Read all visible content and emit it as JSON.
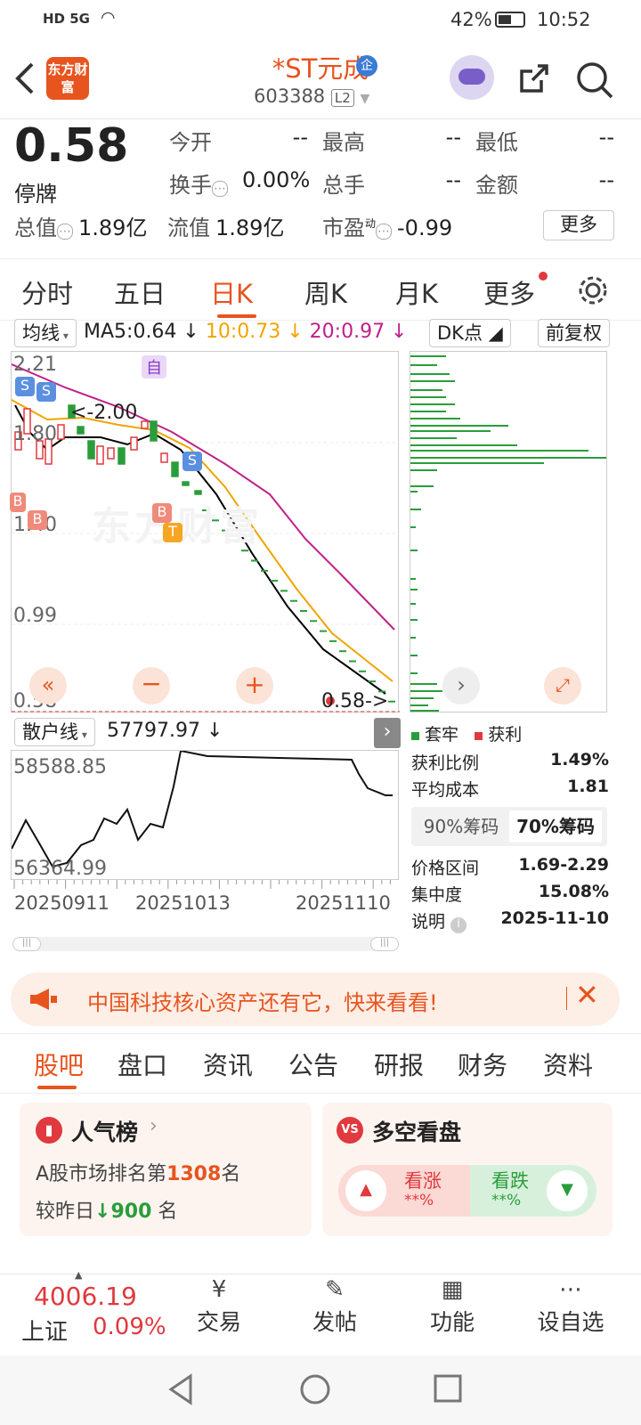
{
  "status_bar": {
    "left": "HD 5G",
    "battery": "42%",
    "time": "10:52"
  },
  "header": {
    "logo": "东方财富",
    "title": "*ST元成",
    "code": "603388",
    "level": "L2"
  },
  "quote": {
    "price": "0.58",
    "status": "停牌",
    "fields": [
      {
        "label": "今开",
        "value": "--"
      },
      {
        "label": "最高",
        "value": "--"
      },
      {
        "label": "最低",
        "value": "--"
      },
      {
        "label": "换手",
        "value": "0.00%"
      },
      {
        "label": "总手",
        "value": "--"
      },
      {
        "label": "金额",
        "value": "--"
      },
      {
        "label": "总值",
        "value": "1.89亿"
      },
      {
        "label": "流值",
        "value": "1.89亿"
      },
      {
        "label": "市盈",
        "value": "-0.99",
        "sup": "动"
      }
    ],
    "more": "更多"
  },
  "period_tabs": [
    "分时",
    "五日",
    "日K",
    "周K",
    "月K",
    "更多"
  ],
  "ma_bar": {
    "selector": "均线",
    "ma5": "MA5:0.64",
    "ma10": "10:0.73",
    "ma20": "20:0.97",
    "dk": "DK点",
    "adjust": "前复权"
  },
  "kline": {
    "y_labels": [
      "2.21",
      "1.80",
      "1.40",
      "0.99",
      "0.58"
    ],
    "annotations": {
      "low": "<-2.00",
      "last": "0.58->",
      "self": "自"
    },
    "markers": {
      "s": "S",
      "b": "B",
      "t": "T"
    },
    "watermark": "东方财富"
  },
  "sub_chart": {
    "selector": "散户线",
    "value": "57797.97",
    "y_labels": [
      "58588.85",
      "56364.99"
    ],
    "dates": [
      "20250911",
      "20251013",
      "20251110"
    ]
  },
  "chips": {
    "legend": [
      "套牢",
      "获利"
    ],
    "rows": [
      {
        "label": "获利比例",
        "value": "1.49%"
      },
      {
        "label": "平均成本",
        "value": "1.81"
      }
    ],
    "tabs": [
      "90%筹码",
      "70%筹码"
    ],
    "rows2": [
      {
        "label": "价格区间",
        "value": "1.69-2.29"
      },
      {
        "label": "集中度",
        "value": "15.08%"
      },
      {
        "label": "说明",
        "value": "2025-11-10"
      }
    ]
  },
  "banner": {
    "text": "中国科技核心资产还有它，快来看看!"
  },
  "content_tabs": [
    "股吧",
    "盘口",
    "资讯",
    "公告",
    "研报",
    "财务",
    "资料"
  ],
  "cards": {
    "popularity": {
      "title": "人气榜",
      "line1_prefix": "A股市场排名第",
      "rank": "1308",
      "line1_suffix": "名",
      "line2_prefix": "较昨日",
      "change": "900",
      "line2_suffix": "名"
    },
    "bullbear": {
      "title": "多空看盘",
      "up": "看涨",
      "down": "看跌",
      "up_val": "**%",
      "down_val": "**%"
    }
  },
  "bottom_nav": {
    "index_value": "4006.19",
    "index_name": "上证",
    "index_change": "0.09%",
    "items": [
      "交易",
      "发帖",
      "功能",
      "设自选"
    ]
  },
  "colors": {
    "accent": "#e8541e",
    "red": "#e0393e",
    "green": "#2a9d3a",
    "ma5": "#000000",
    "ma10": "#f0a500",
    "ma20": "#c0208a"
  }
}
